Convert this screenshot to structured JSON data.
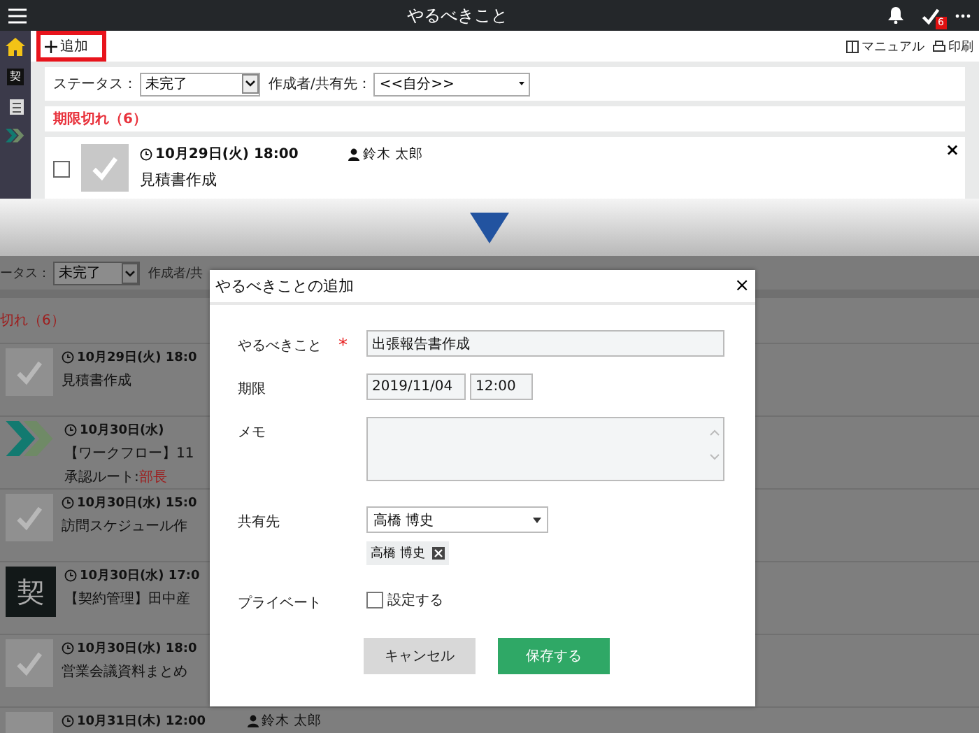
{
  "header": {
    "title": "やるべきこと",
    "badge": "6"
  },
  "sidebar": {
    "items": [
      {
        "kind": "home"
      },
      {
        "kind": "contract",
        "label": "契"
      },
      {
        "kind": "document"
      },
      {
        "kind": "workflow"
      }
    ]
  },
  "toolbar": {
    "add_label": "追加",
    "highlighted": true,
    "links": [
      {
        "kind": "manual",
        "label": "マニュアル"
      },
      {
        "kind": "print",
        "label": "印刷"
      }
    ]
  },
  "filters": {
    "status_label": "ステータス：",
    "status_value": "未完了",
    "owner_label": "作成者/共有先：",
    "owner_value": "<<自分>>"
  },
  "section": {
    "title": "期限切れ（6）"
  },
  "task": {
    "checked": false,
    "due": "10月29日(火) 18:00",
    "owner": "鈴木 太郎",
    "title": "見積書作成",
    "close": "×"
  },
  "background": {
    "status_label": "ータス：",
    "status_value": "未完了",
    "owner_label": "作成者/共",
    "section_title": "切れ（6）",
    "tasks": [
      {
        "kind": "check",
        "due": "10月29日(火) 18:0",
        "title": "見積書作成"
      },
      {
        "kind": "workflow",
        "due": "10月30日(水)",
        "title": "【ワークフロー】11",
        "note_label": "承認ルート: ",
        "note_value": "部長"
      },
      {
        "kind": "check",
        "due": "10月30日(水) 15:0",
        "title": "訪問スケジュール作"
      },
      {
        "kind": "contract",
        "icon_label": "契",
        "due": "10月30日(水) 17:0",
        "title": "【契約管理】田中産"
      },
      {
        "kind": "check",
        "due": "10月30日(水) 18:0",
        "title": "営業会議資料まとめ"
      },
      {
        "kind": "plain",
        "due": "10月31日(木) 12:00",
        "owner": "鈴木 太郎"
      }
    ]
  },
  "dialog": {
    "title": "やるべきことの追加",
    "close": "×",
    "task_label": "やるべきこと",
    "required_mark": "*",
    "task_value": "出張報告書作成",
    "due_label": "期限",
    "date_value": "2019/11/04",
    "time_value": "12:00",
    "memo_label": "メモ",
    "share_label": "共有先",
    "share_value": "高橋 博史",
    "share_tags": [
      "高橋 博史"
    ],
    "private_label": "プライベート",
    "private_option": "設定する",
    "private_checked": false,
    "cancel": "キャンセル",
    "save": "保存する"
  }
}
